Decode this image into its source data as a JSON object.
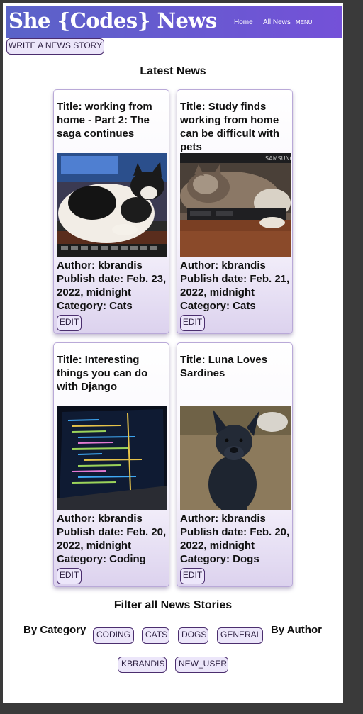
{
  "header": {
    "brand": "She {Codes} News",
    "nav": {
      "home": "Home",
      "all_news": "All News",
      "menu": "MENU"
    }
  },
  "actions": {
    "write_story": "WRITE A NEWS STORY"
  },
  "latest": {
    "heading": "Latest News",
    "cards": [
      {
        "title": "Title: working from home - Part 2: The saga continues",
        "author": "Author: kbrandis",
        "publish": "Publish date: Feb. 23, 2022, midnight",
        "category": "Category: Cats",
        "edit": "EDIT",
        "image_icon": "cat-photo"
      },
      {
        "title": "Title: Study finds working from home can be difficult with pets",
        "author": "Author: kbrandis",
        "publish": "Publish date: Feb. 21, 2022, midnight",
        "category": "Category: Cats",
        "edit": "EDIT",
        "image_icon": "cat-on-laptop-photo",
        "image_text": "SAMSUNG"
      },
      {
        "title": "Title: Interesting things you can do with Django",
        "author": "Author: kbrandis",
        "publish": "Publish date: Feb. 20, 2022, midnight",
        "category": "Category: Coding",
        "edit": "EDIT",
        "image_icon": "code-laptop-photo"
      },
      {
        "title": "Title: Luna Loves Sardines",
        "author": "Author: kbrandis",
        "publish": "Publish date: Feb. 20, 2022, midnight",
        "category": "Category: Dogs",
        "edit": "EDIT",
        "image_icon": "dog-photo"
      }
    ]
  },
  "filters": {
    "heading": "Filter all News Stories",
    "by_category": "By Category",
    "by_author": "By Author",
    "categories": [
      "CODING",
      "CATS",
      "DOGS",
      "GENERAL"
    ],
    "authors": [
      "KBRANDIS",
      "NEW_USER"
    ]
  },
  "colors": {
    "navbar_start": "#5a63c8",
    "navbar_end": "#7451d8",
    "button_bg": "#ece6fa",
    "button_border": "#4b2e6e",
    "card_border": "#b9a9d8"
  }
}
